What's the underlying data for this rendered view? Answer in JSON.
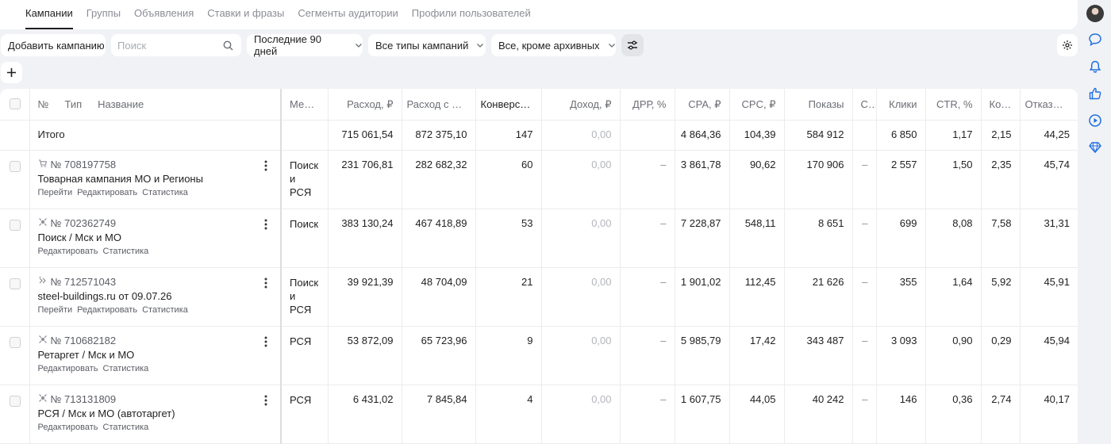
{
  "tabs": [
    "Кампании",
    "Группы",
    "Объявления",
    "Ставки и фразы",
    "Сегменты аудитории",
    "Профили пользователей"
  ],
  "toolbar": {
    "add_campaign": "Добавить кампанию",
    "search_placeholder": "Поиск",
    "period": "Последние 90 дней",
    "types": "Все типы кампаний",
    "status": "Все, кроме архивных"
  },
  "table": {
    "headers": {
      "num": "№",
      "type": "Тип",
      "name": "Название",
      "places": "Места",
      "cost": "Расход, ₽",
      "cost_vat": "Расход с Н…",
      "conv": "Конверс…",
      "income": "Доход, ₽",
      "drr": "ДРР, %",
      "cpa": "CPA, ₽",
      "cpc": "CPC, ₽",
      "shows": "Показы",
      "c": "С",
      "clicks": "Клики",
      "ctr": "CTR, %",
      "ko": "Ко…",
      "bounce": "Отказы, %"
    },
    "total": {
      "label": "Итого",
      "cost": "715 061,54",
      "cost_vat": "872 375,10",
      "conv": "147",
      "income": "0,00",
      "drr": "",
      "cpa": "4 864,36",
      "cpc": "104,39",
      "shows": "584 912",
      "c": "",
      "clicks": "6 850",
      "ctr": "1,17",
      "ko": "2,15",
      "bounce": "44,25"
    },
    "rows": [
      {
        "id": "№ 708197758",
        "icon": "cart-icon",
        "name": "Товарная кампания МО и Регионы",
        "links": [
          "Перейти",
          "Редактировать",
          "Статистика"
        ],
        "places": "Поиск и РСЯ",
        "cost": "231 706,81",
        "cost_vat": "282 682,32",
        "conv": "60",
        "income": "0,00",
        "drr": "–",
        "cpa": "3 861,78",
        "cpc": "90,62",
        "shows": "170 906",
        "c": "–",
        "clicks": "2 557",
        "ctr": "1,50",
        "ko": "2,35",
        "bounce": "45,74"
      },
      {
        "id": "№ 702362749",
        "icon": "unified-campaign-icon",
        "name": "Поиск / Мск и МО",
        "links": [
          "Редактировать",
          "Статистика"
        ],
        "places": "Поиск",
        "cost": "383 130,24",
        "cost_vat": "467 418,89",
        "conv": "53",
        "income": "0,00",
        "drr": "–",
        "cpa": "7 228,87",
        "cpc": "548,11",
        "shows": "8 651",
        "c": "–",
        "clicks": "699",
        "ctr": "8,08",
        "ko": "7,58",
        "bounce": "31,31"
      },
      {
        "id": "№ 712571043",
        "icon": "master-campaign-icon",
        "name": "steel-buildings.ru от 09.07.26",
        "links": [
          "Перейти",
          "Редактировать",
          "Статистика"
        ],
        "places": "Поиск и РСЯ",
        "cost": "39 921,39",
        "cost_vat": "48 704,09",
        "conv": "21",
        "income": "0,00",
        "drr": "–",
        "cpa": "1 901,02",
        "cpc": "112,45",
        "shows": "21 626",
        "c": "–",
        "clicks": "355",
        "ctr": "1,64",
        "ko": "5,92",
        "bounce": "45,91"
      },
      {
        "id": "№ 710682182",
        "icon": "unified-campaign-icon",
        "name": "Ретаргет / Мск и МО",
        "links": [
          "Редактировать",
          "Статистика"
        ],
        "places": "РСЯ",
        "cost": "53 872,09",
        "cost_vat": "65 723,96",
        "conv": "9",
        "income": "0,00",
        "drr": "–",
        "cpa": "5 985,79",
        "cpc": "17,42",
        "shows": "343 487",
        "c": "–",
        "clicks": "3 093",
        "ctr": "0,90",
        "ko": "0,29",
        "bounce": "45,94"
      },
      {
        "id": "№ 713131809",
        "icon": "unified-campaign-icon",
        "name": "РСЯ / Мск и МО (автотаргет)",
        "links": [
          "Редактировать",
          "Статистика"
        ],
        "places": "РСЯ",
        "cost": "6 431,02",
        "cost_vat": "7 845,84",
        "conv": "4",
        "income": "0,00",
        "drr": "–",
        "cpa": "1 607,75",
        "cpc": "44,05",
        "shows": "40 242",
        "c": "–",
        "clicks": "146",
        "ctr": "0,36",
        "ko": "2,74",
        "bounce": "40,17"
      }
    ]
  },
  "rail_icons": [
    "avatar",
    "chat-icon",
    "bell-icon",
    "thumbs-up-icon",
    "play-icon",
    "diamond-icon"
  ]
}
